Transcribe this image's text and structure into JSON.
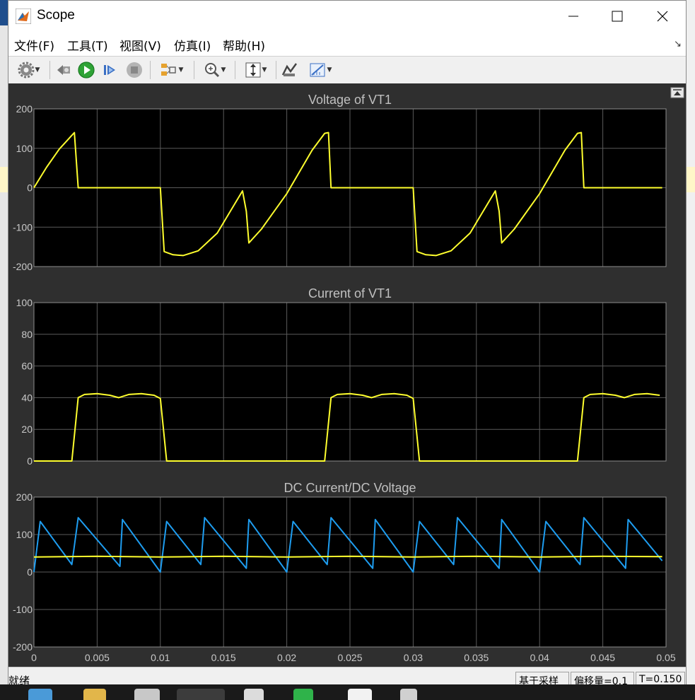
{
  "window": {
    "title": "Scope"
  },
  "menu": [
    "文件(F)",
    "工具(T)",
    "视图(V)",
    "仿真(I)",
    "帮助(H)"
  ],
  "toolbar": {
    "items": [
      "gear-icon",
      "restore-icon",
      "run-icon",
      "step-forward-icon",
      "stop-icon",
      "signal-selector-icon",
      "zoom-icon",
      "autoscale-icon",
      "style-icon",
      "cursor-measure-icon"
    ]
  },
  "plots": [
    {
      "title": "Voltage of VT1",
      "ylim": [
        -200,
        200
      ],
      "yticks": [
        -200,
        -100,
        0,
        100,
        200
      ],
      "show_xticklabels": false
    },
    {
      "title": "Current of VT1",
      "ylim": [
        0,
        100
      ],
      "yticks": [
        0,
        20,
        40,
        60,
        80,
        100
      ],
      "show_xticklabels": false
    },
    {
      "title": "DC Current/DC Voltage",
      "ylim": [
        -200,
        200
      ],
      "yticks": [
        -200,
        -100,
        0,
        100,
        200
      ],
      "show_xticklabels": true
    }
  ],
  "xaxis": {
    "xlim": [
      0,
      0.05
    ],
    "ticks": [
      "0",
      "0.005",
      "0.01",
      "0.015",
      "0.02",
      "0.025",
      "0.03",
      "0.035",
      "0.04",
      "0.045",
      "0.05"
    ]
  },
  "colors": {
    "yellow": "#ffff2e",
    "blue": "#1e9df0",
    "grid": "#5a5a5a",
    "axes_bg": "#000000",
    "panel_bg": "#2f2f2f",
    "title": "#c0c0c0",
    "tick": "#c8c8c8"
  },
  "chart_data": [
    {
      "type": "line",
      "title": "Voltage of VT1",
      "ylim": [
        -200,
        200
      ],
      "xlim": [
        0,
        0.05
      ],
      "grid": true,
      "series": [
        {
          "color": "#ffff2e",
          "x": [
            0,
            0.001,
            0.002,
            0.003,
            0.0032,
            0.0035,
            0.01,
            0.0103,
            0.011,
            0.0118,
            0.013,
            0.0145,
            0.0165,
            0.0168,
            0.017,
            0.018,
            0.02,
            0.022,
            0.023,
            0.0233,
            0.0235,
            0.03,
            0.0303,
            0.031,
            0.0318,
            0.033,
            0.0345,
            0.0365,
            0.0368,
            0.037,
            0.038,
            0.04,
            0.042,
            0.043,
            0.0433,
            0.0435,
            0.0497
          ],
          "y": [
            0,
            52,
            98,
            133,
            140,
            0,
            0,
            -162,
            -170,
            -172,
            -160,
            -115,
            -8,
            -60,
            -140,
            -105,
            -15,
            95,
            138,
            140,
            0,
            0,
            -162,
            -170,
            -172,
            -160,
            -115,
            -8,
            -60,
            -140,
            -105,
            -15,
            95,
            138,
            140,
            0,
            0
          ]
        }
      ]
    },
    {
      "type": "line",
      "title": "Current of VT1",
      "ylim": [
        0,
        100
      ],
      "xlim": [
        0,
        0.05
      ],
      "grid": true,
      "series": [
        {
          "color": "#ffff2e",
          "x": [
            0,
            0.003,
            0.0035,
            0.004,
            0.005,
            0.006,
            0.0067,
            0.0075,
            0.0085,
            0.0095,
            0.01,
            0.0105,
            0.023,
            0.0235,
            0.024,
            0.025,
            0.026,
            0.0267,
            0.0275,
            0.0285,
            0.0295,
            0.03,
            0.0305,
            0.043,
            0.0435,
            0.044,
            0.045,
            0.046,
            0.0467,
            0.0475,
            0.0485,
            0.0495
          ],
          "y": [
            0,
            0,
            40,
            42,
            42.5,
            41.5,
            40,
            42,
            42.5,
            41.5,
            39.5,
            0,
            0,
            40,
            42,
            42.5,
            41.5,
            40,
            42,
            42.5,
            41.5,
            39.5,
            0,
            0,
            40,
            42,
            42.5,
            41.5,
            40,
            42,
            42.5,
            41.5
          ]
        }
      ]
    },
    {
      "type": "line",
      "title": "DC Current/DC Voltage",
      "ylim": [
        -200,
        200
      ],
      "xlim": [
        0,
        0.05
      ],
      "grid": true,
      "series": [
        {
          "color": "#1e9df0",
          "x": [
            0,
            0.0005,
            0.003,
            0.0035,
            0.0068,
            0.007,
            0.01,
            0.0105,
            0.0132,
            0.0135,
            0.0168,
            0.017,
            0.02,
            0.0205,
            0.0232,
            0.0235,
            0.0268,
            0.027,
            0.03,
            0.0305,
            0.0332,
            0.0335,
            0.0368,
            0.037,
            0.04,
            0.0405,
            0.0432,
            0.0435,
            0.0468,
            0.047,
            0.0497
          ],
          "y": [
            0,
            135,
            20,
            145,
            15,
            140,
            0,
            135,
            20,
            145,
            10,
            140,
            0,
            135,
            20,
            145,
            10,
            140,
            0,
            135,
            20,
            145,
            10,
            140,
            0,
            135,
            20,
            145,
            10,
            140,
            30
          ]
        },
        {
          "color": "#ffff2e",
          "x": [
            0,
            0.005,
            0.01,
            0.015,
            0.02,
            0.025,
            0.03,
            0.035,
            0.04,
            0.045,
            0.0497
          ],
          "y": [
            40,
            42,
            40,
            42,
            40,
            42,
            40,
            42,
            40,
            42,
            41
          ]
        }
      ]
    }
  ],
  "status": {
    "text": "就绪",
    "mode": "基于采样",
    "offset": "偏移量=0.1",
    "time": "T=0.150"
  }
}
